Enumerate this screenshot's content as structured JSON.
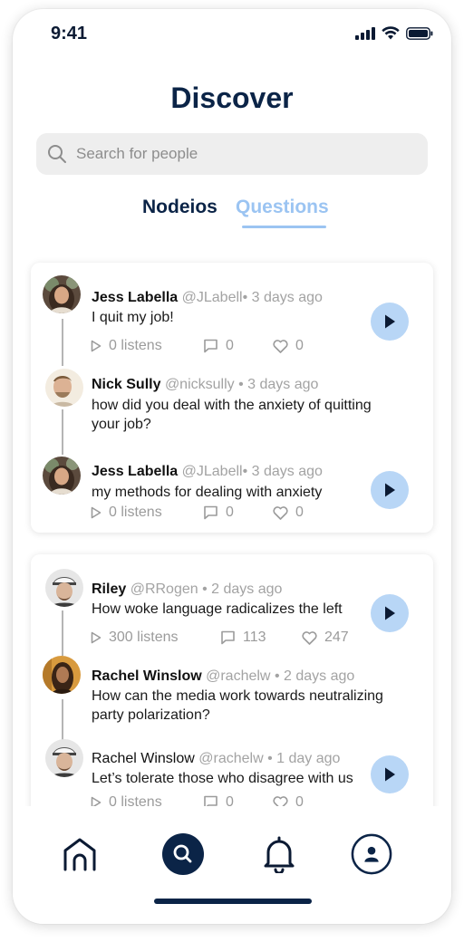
{
  "status_bar": {
    "time": "9:41"
  },
  "page": {
    "title": "Discover"
  },
  "search": {
    "placeholder": "Search for people"
  },
  "tabs": [
    {
      "label": "Nodeios",
      "active": false
    },
    {
      "label": "Questions",
      "active": true
    }
  ],
  "colors": {
    "accent": "#9bc4f2",
    "navy": "#0b2447",
    "play_bg": "#b8d6f6"
  },
  "threads": [
    {
      "posts": [
        {
          "name": "Jess Labella",
          "handle": "@JLabell",
          "time": "• 3 days ago",
          "text": "I quit my job!",
          "listens": "0 listens",
          "comments": "0",
          "likes": "0"
        },
        {
          "name": "Nick Sully",
          "handle": "@nicksully",
          "time": "• 3 days ago",
          "text": "how did you deal with the anxiety of quitting your job?"
        },
        {
          "name": "Jess Labella",
          "handle": "@JLabell",
          "time": "• 3 days ago",
          "text": "my methods for dealing with anxiety",
          "listens": "0 listens",
          "comments": "0",
          "likes": "0"
        }
      ]
    },
    {
      "posts": [
        {
          "name": "Riley",
          "handle": "@RRogen",
          "time": "• 2 days ago",
          "text": "How woke language radicalizes the left",
          "listens": "300 listens",
          "comments": "113",
          "likes": "247"
        },
        {
          "name": "Rachel Winslow",
          "handle": "@rachelw",
          "time": "• 2 days ago",
          "text": "How can the media work towards neutralizing party polarization?"
        },
        {
          "name": "Rachel Winslow",
          "handle": "@rachelw",
          "time": "• 1 day ago",
          "text": "Let’s tolerate those who disagree with us",
          "listens": "0 listens",
          "comments": "0",
          "likes": "0"
        }
      ]
    }
  ],
  "nav": [
    "home-icon",
    "search-icon",
    "bell-icon",
    "profile-icon"
  ]
}
